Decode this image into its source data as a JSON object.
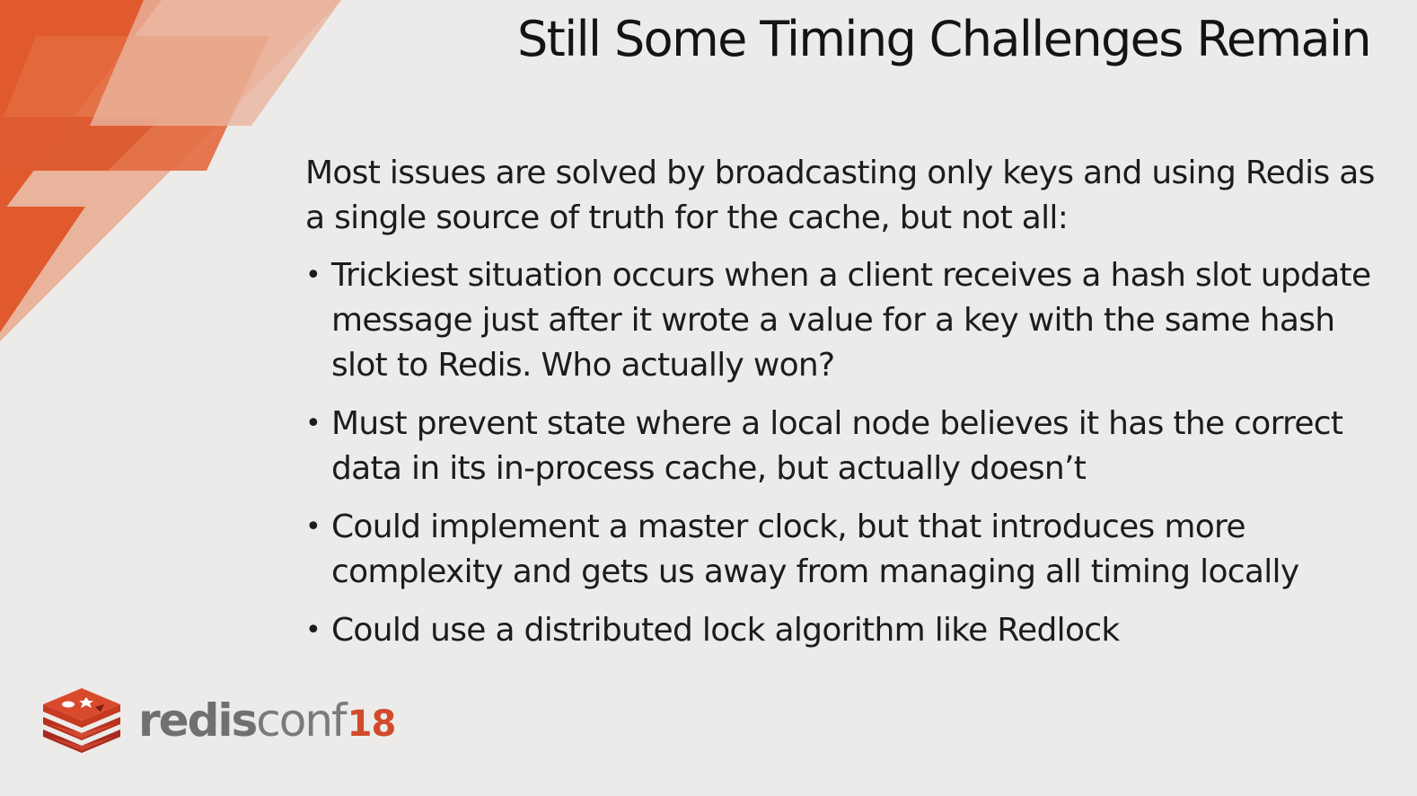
{
  "slide": {
    "title": "Still Some Timing Challenges Remain",
    "intro": "Most issues are solved by broadcasting only keys and using Redis as a single source of truth for the cache, but not all:",
    "bullets": [
      "Trickiest situation occurs when a client receives a hash slot update message just after it wrote a value for a key with the same hash slot to Redis.  Who actually won?",
      "Must prevent state where a local node believes it has the correct data in its in-process cache, but actually doesn’t",
      "Could implement a master clock, but that introduces more complexity and gets us away from managing all timing locally",
      "Could use a distributed lock algorithm like Redlock"
    ],
    "bullet_glyph": "•"
  },
  "logo": {
    "icon": "redis-cube-icon",
    "text_bold": "redis",
    "text_light": "conf",
    "text_number": "18"
  },
  "colors": {
    "background": "#ecebe9",
    "accent_orange": "#e2542a",
    "accent_light": "#e8a58a",
    "logo_red": "#d24a2c"
  }
}
